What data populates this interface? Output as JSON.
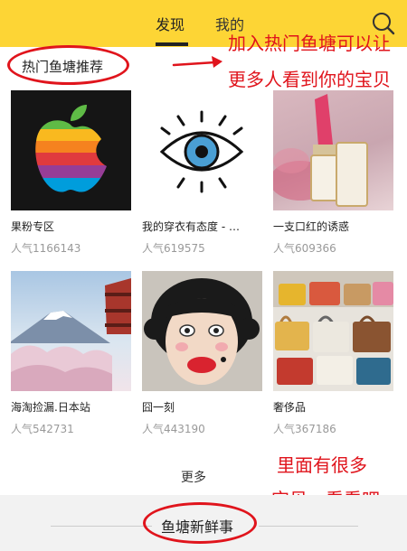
{
  "header": {
    "tabs": [
      {
        "label": "发现",
        "active": true
      },
      {
        "label": "我的",
        "active": false
      }
    ],
    "bg_color": "#fdd535",
    "search_icon": "search-icon"
  },
  "section": {
    "title": "热门鱼塘推荐"
  },
  "annotations": {
    "top_note": [
      "加入热门鱼塘可以让",
      "更多人看到你的宝贝"
    ],
    "bottom_note": [
      "里面有很多",
      "宝贝，看看吧"
    ],
    "color": "#e0141c"
  },
  "ponds": [
    {
      "name": "果粉专区",
      "popularity": "人气1166143"
    },
    {
      "name": "我的穿衣有态度 - …",
      "popularity": "人气619575"
    },
    {
      "name": "一支口红的诱惑",
      "popularity": "人气609366"
    },
    {
      "name": "海淘捡漏.日本站",
      "popularity": "人气542731"
    },
    {
      "name": "囧一刻",
      "popularity": "人气443190"
    },
    {
      "name": "奢侈品",
      "popularity": "人气367186"
    }
  ],
  "more_label": "更多",
  "bottom_section": {
    "title": "鱼塘新鲜事"
  }
}
